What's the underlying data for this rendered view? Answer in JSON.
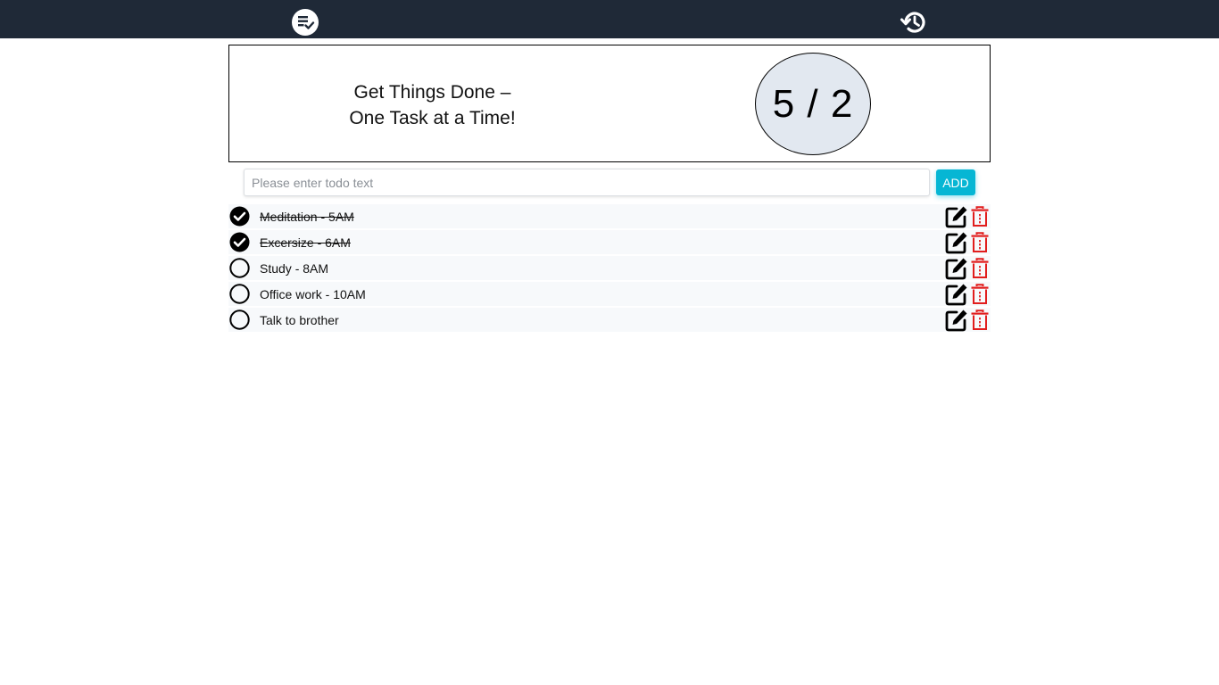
{
  "nav": {
    "todo_icon": "todo-list-check-icon",
    "history_icon": "history-icon"
  },
  "hero": {
    "tagline_line1": "Get Things Done –",
    "tagline_line2": "One Task at a Time!",
    "counter": "5 / 2"
  },
  "input": {
    "placeholder": "Please enter todo text",
    "value": "",
    "add_label": "ADD"
  },
  "todos": [
    {
      "text": "Meditation - 5AM",
      "done": true
    },
    {
      "text": "Excersize - 6AM",
      "done": true
    },
    {
      "text": "Study - 8AM",
      "done": false
    },
    {
      "text": "Office work - 10AM",
      "done": false
    },
    {
      "text": "Talk to brother",
      "done": false
    }
  ],
  "colors": {
    "topbar": "#1f2937",
    "counter_bg": "#e2e8f0",
    "accent": "#06b6d4",
    "delete": "#e11d1d"
  }
}
